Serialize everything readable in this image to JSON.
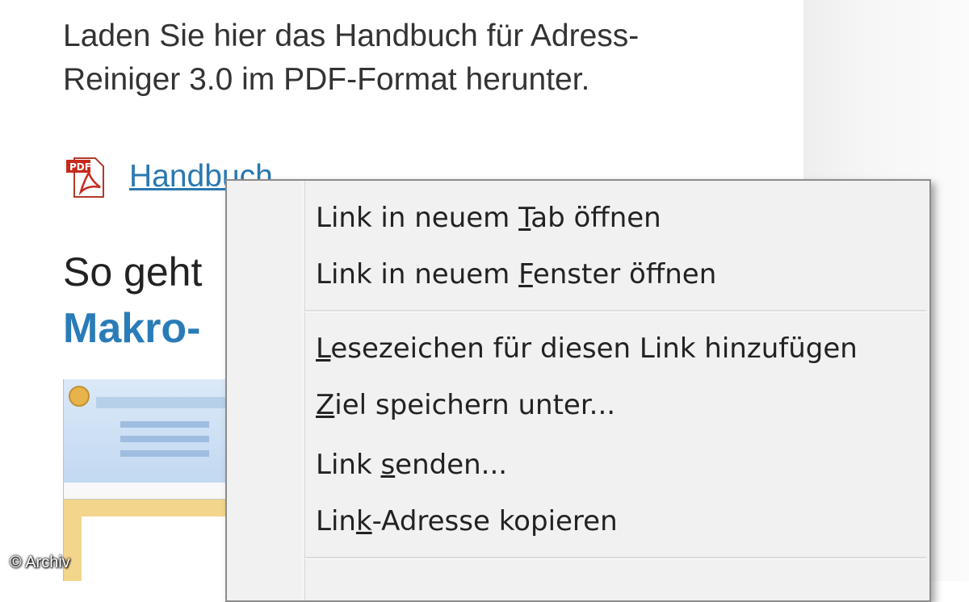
{
  "intro_text": "Laden Sie hier das Handbuch für Adress-Reiniger 3.0 im PDF-Format herunter.",
  "download": {
    "icon": "pdf-icon",
    "link_label": "Handbuch"
  },
  "section": {
    "heading": "So geht",
    "subheading": "Makro-"
  },
  "thumbnail": {
    "description_icon": "excel-screenshot"
  },
  "credit": "© Archiv",
  "context_menu": {
    "items": [
      {
        "before": "Link in neuem ",
        "accel": "T",
        "after": "ab öffnen"
      },
      {
        "before": "Link in neuem ",
        "accel": "F",
        "after": "enster öffnen"
      },
      {
        "before": "",
        "accel": "L",
        "after": "esezeichen für diesen Link hinzufügen"
      },
      {
        "before": "",
        "accel": "Z",
        "after": "iel speichern unter..."
      },
      {
        "before": "Link ",
        "accel": "s",
        "after": "enden..."
      },
      {
        "before": "Lin",
        "accel": "k",
        "after": "-Adresse kopieren"
      }
    ]
  },
  "colors": {
    "link": "#2a78b0",
    "heading_blue": "#2a7cb8",
    "menu_bg": "#f1f1f1"
  }
}
